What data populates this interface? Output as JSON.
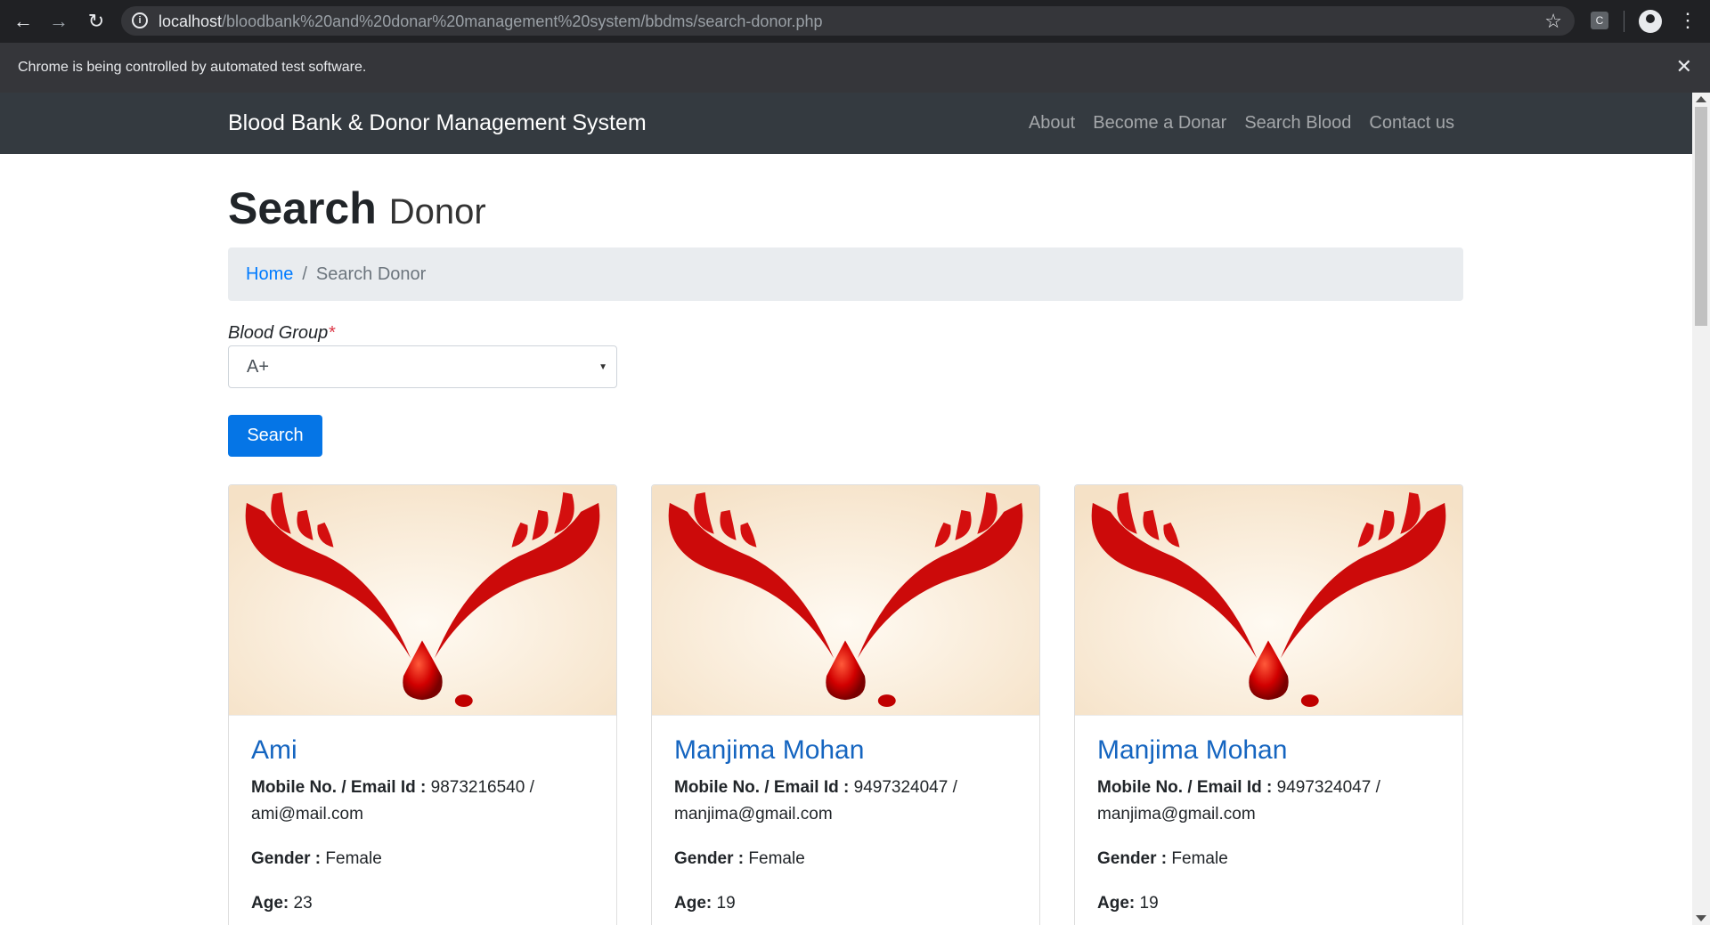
{
  "browser": {
    "url_host": "localhost",
    "url_path": "/bloodbank%20and%20donar%20management%20system/bbdms/search-donor.php",
    "extension_label": "C",
    "infobar_text": "Chrome is being controlled by automated test software."
  },
  "navbar": {
    "brand": "Blood Bank & Donor Management System",
    "links": [
      "About",
      "Become a Donar",
      "Search Blood",
      "Contact us"
    ]
  },
  "page": {
    "title_bold": "Search",
    "title_light": "Donor",
    "breadcrumb": {
      "home": "Home",
      "sep": "/",
      "current": "Search Donor"
    }
  },
  "form": {
    "label": "Blood Group",
    "required_mark": "*",
    "selected": "A+",
    "search_label": "Search"
  },
  "labels": {
    "contact": "Mobile No. / Email Id :",
    "gender": "Gender :",
    "age": "Age:"
  },
  "donors": [
    {
      "name": "Ami",
      "mobile": "9873216540 /",
      "email": "ami@mail.com",
      "gender": "Female",
      "age": "23"
    },
    {
      "name": "Manjima Mohan",
      "mobile": "9497324047 /",
      "email": "manjima@gmail.com",
      "gender": "Female",
      "age": "19"
    },
    {
      "name": "Manjima Mohan",
      "mobile": "9497324047 /",
      "email": "manjima@gmail.com",
      "gender": "Female",
      "age": "19"
    }
  ],
  "colors": {
    "navbar": "#343a40",
    "primary": "#0575e6",
    "donor_name": "#1565c0",
    "browser": "#202124"
  }
}
